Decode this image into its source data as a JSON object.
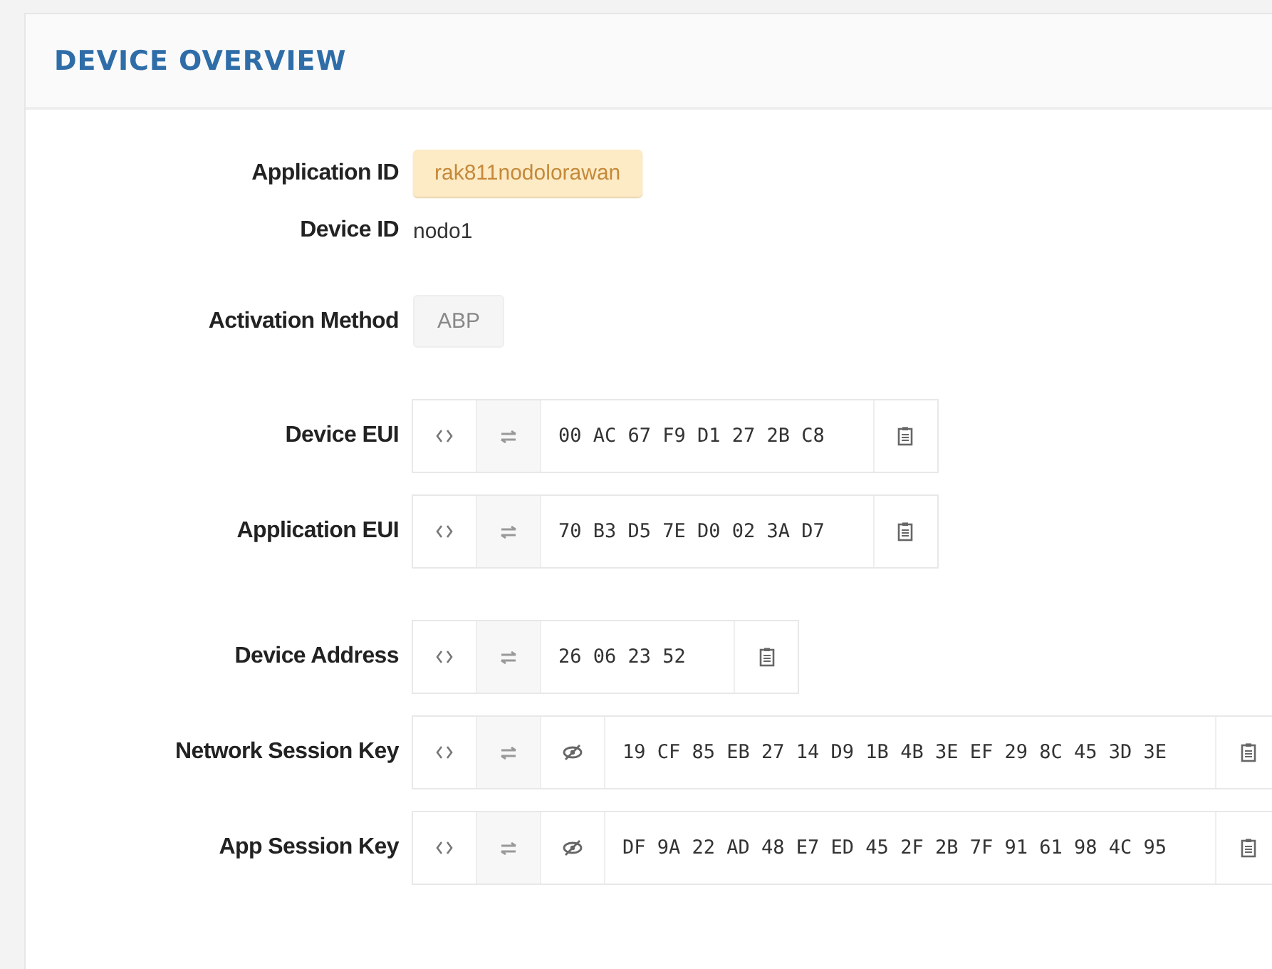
{
  "panel": {
    "title": "DEVICE OVERVIEW"
  },
  "sections": [
    {
      "fields": [
        {
          "label": "Application ID",
          "kind": "badge",
          "value": "rak811nodolorawan"
        },
        {
          "label": "Device ID",
          "kind": "text",
          "value": "nodo1"
        }
      ]
    },
    {
      "fields": [
        {
          "label": "Activation Method",
          "kind": "tag",
          "value": "ABP"
        }
      ]
    },
    {
      "fields": [
        {
          "label": "Device EUI",
          "kind": "key",
          "value": "00 AC 67 F9 D1 27 2B C8",
          "hidden": false
        },
        {
          "label": "Application EUI",
          "kind": "key",
          "value": "70 B3 D5 7E D0 02 3A D7",
          "hidden": false
        }
      ]
    },
    {
      "fields": [
        {
          "label": "Device Address",
          "kind": "key",
          "value": "26 06 23 52",
          "hidden": false
        },
        {
          "label": "Network Session Key",
          "kind": "key",
          "value": "19 CF 85 EB 27 14 D9 1B 4B 3E EF 29 8C 45 3D 3E",
          "hidden": true
        },
        {
          "label": "App Session Key",
          "kind": "key",
          "value": "DF 9A 22 AD 48 E7 ED 45 2F 2B 7F 91 61 98 4C 95",
          "hidden": true
        }
      ]
    }
  ]
}
